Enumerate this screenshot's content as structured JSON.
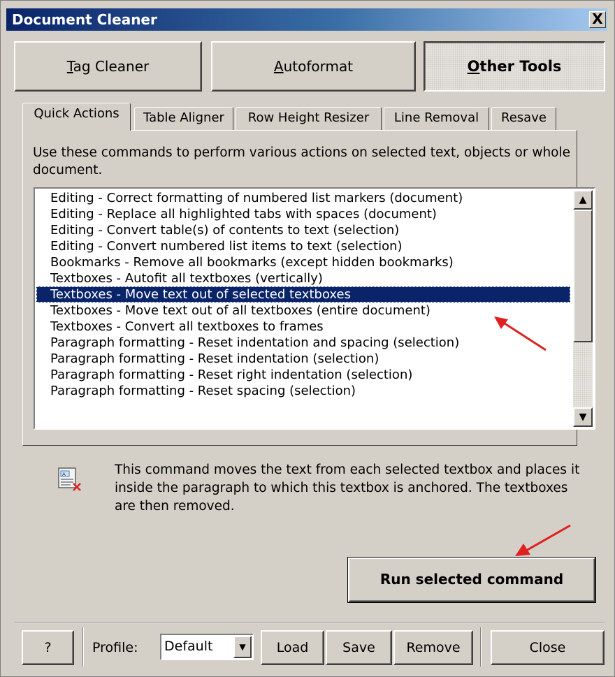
{
  "window": {
    "title": "Document Cleaner",
    "close_label": "X"
  },
  "main_tabs": [
    {
      "label_first": "T",
      "label_rest": "ag Cleaner"
    },
    {
      "label_first": "A",
      "label_rest": "utoformat"
    },
    {
      "label_first": "O",
      "label_rest": "ther Tools"
    }
  ],
  "sub_tabs": [
    "Quick Actions",
    "Table Aligner",
    "Row Height Resizer",
    "Line Removal",
    "Resave"
  ],
  "description": "Use these commands to perform various actions on selected text, objects or whole document.",
  "commands": [
    "Editing - Correct formatting of numbered list markers (document)",
    "Editing - Replace all highlighted tabs with spaces (document)",
    "Editing - Convert table(s) of contents to text (selection)",
    "Editing - Convert numbered list items to text (selection)",
    "Bookmarks - Remove all bookmarks (except hidden bookmarks)",
    "Textboxes - Autofit all textboxes (vertically)",
    "Textboxes - Move text out of selected textboxes",
    "Textboxes - Move text out of all textboxes (entire document)",
    "Textboxes - Convert all textboxes to frames",
    "Paragraph formatting - Reset indentation and spacing (selection)",
    "Paragraph formatting - Reset indentation (selection)",
    "Paragraph formatting - Reset right indentation (selection)",
    "Paragraph formatting - Reset spacing (selection)"
  ],
  "selected_index": 6,
  "command_description": "This command moves the text from each selected textbox and places it inside the paragraph to which this textbox is anchored. The textboxes are then removed.",
  "run_button": "Run selected command",
  "footer": {
    "help_label": "?",
    "profile_label": "Profile:",
    "profile_value": "Default",
    "load_label": "Load",
    "save_label": "Save",
    "remove_label": "Remove",
    "close_label": "Close"
  },
  "icons": {
    "command_icon": "textbox-remove-icon",
    "scroll_up": "arrow-up-icon",
    "scroll_down": "arrow-down-icon",
    "combo_dropdown": "chevron-down-icon"
  },
  "colors": {
    "title_start": "#0a246a",
    "title_end": "#a6caf0",
    "selection": "#0a246a",
    "annotation_arrow": "#e02020"
  }
}
